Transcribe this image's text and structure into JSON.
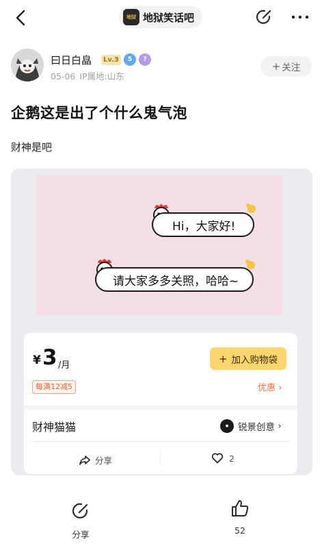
{
  "topbar": {
    "forum_name": "地狱笑话吧",
    "forum_avatar_text": "地狱"
  },
  "author": {
    "name": "曰日白皛",
    "level": "Lv.3",
    "badge_blue": "5",
    "badge_purple": "?",
    "date": "05-06",
    "ip": "IP属地:山东",
    "follow_label": "关注"
  },
  "post": {
    "title": "企鹅这是出了个什么鬼气泡",
    "body": "财神是吧"
  },
  "card": {
    "sticker": {
      "bubble1": "Hi，大家好!",
      "bubble2": "请大家多多关照，哈哈~"
    },
    "currency": "¥",
    "price": "3",
    "unit": "/月",
    "add_to_cart": "加入购物袋",
    "discount": "每满12减5",
    "promo": "优惠",
    "product_name": "财神猫猫",
    "brand_name": "锐景创意",
    "share_label": "分享",
    "like_count": "2"
  },
  "bottom": {
    "share_label": "分享",
    "like_count": "52"
  },
  "colors": {
    "add_cart_bg": "#fbd66f",
    "promo": "#f0713f",
    "sticker_bg": "#f3dfe4",
    "badge_level_bg": "#f4e3b4"
  },
  "icons": {
    "back": "back-chevron-icon",
    "edit": "edit-icon",
    "more": "more-dots-icon",
    "share": "share-arrow-icon",
    "like": "heart-icon",
    "thumb": "thumbs-up-icon"
  }
}
